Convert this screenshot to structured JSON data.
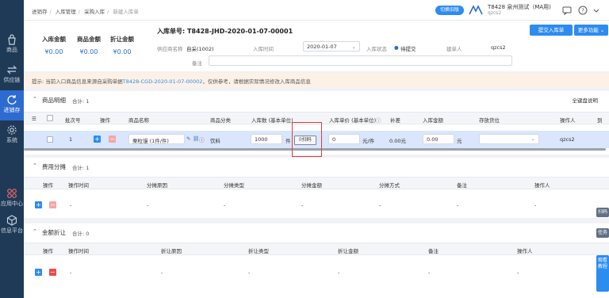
{
  "sidebar": {
    "items": [
      {
        "label": "商品",
        "icon": "bag-icon"
      },
      {
        "label": "供应链",
        "icon": "swap-icon"
      },
      {
        "label": "进销存",
        "icon": "refresh-icon",
        "active": true
      },
      {
        "label": "系统",
        "icon": "gear-icon"
      },
      {
        "label": "应用中心",
        "icon": "apps-icon"
      },
      {
        "label": "信息平台",
        "icon": "cube-icon"
      }
    ]
  },
  "topbar": {
    "breadcrumb": [
      "进销存",
      "入库管理",
      "采购入库",
      "新建入库单"
    ],
    "switch_label": "切换旧版",
    "company_name": "T8428 泉州测试（MA用)",
    "company_user": "qzcs2"
  },
  "header": {
    "stats": [
      {
        "label": "入库金额",
        "value": "¥0.00"
      },
      {
        "label": "商品金额",
        "value": "¥0.00"
      },
      {
        "label": "折让金额",
        "value": "¥0.00"
      }
    ],
    "order_no": "入库单号: T8428-JHD-2020-01-07-00001",
    "supplier_label": "供应商名称",
    "supplier_value": "自采(1002)",
    "date_label": "入库时间",
    "date_value": "2020-01-07",
    "status_label": "入库状态",
    "status_value": "待提交",
    "creator_label": "建单人",
    "creator_value": "qzcs2",
    "remark_label": "备注",
    "remark_value": "",
    "submit_label": "提交入库单",
    "more_label": "更多功能"
  },
  "tip": {
    "prefix": "提示: 当前入口商品信息来源自采购单据",
    "link": "T8428-CGD-2020-01-07-00002",
    "suffix": "，仅供参考，请根据实际情况修改入库商品信息"
  },
  "goods": {
    "title": "商品明细",
    "count": "合计: 1",
    "right_label": "全键盘说明",
    "columns": [
      "批次号",
      "操作",
      "商品名称",
      "商品分类",
      "入库数 (基本单位)",
      "入库单价 (基本单位)",
      "补差",
      "入库金额",
      "存放货位",
      "操作人",
      "到"
    ],
    "row": {
      "batch": "1",
      "name": "栗粒馒 (1件/件)",
      "category": "饮料",
      "qty": "1000",
      "unit": "件",
      "scan_label": "扫码",
      "price": "0",
      "price_unit": "元/件",
      "diff": "0.00元",
      "amount": "0.00",
      "amount_unit": "元",
      "location": "",
      "operator": "qzcs2"
    }
  },
  "alloc": {
    "title": "费用分摊",
    "count": "合计: 1",
    "columns": [
      "操作",
      "操作时间",
      "分摊原因",
      "分摊类型",
      "分摊金额",
      "分摊方式",
      "备注",
      "操作人"
    ],
    "row_cells": [
      "-",
      "-",
      "-",
      "-",
      "-",
      "-",
      "-"
    ]
  },
  "discount": {
    "title": "金额折让",
    "count": "合计: 0",
    "columns": [
      "操作",
      "操作时间",
      "折让原因",
      "折让类型",
      "折让金额",
      "备注",
      "操作人"
    ],
    "row_cells": [
      "-",
      "-",
      "-",
      "-",
      "-",
      "-"
    ]
  },
  "float_buttons": [
    "扫码",
    "任务",
    "观看教程"
  ]
}
